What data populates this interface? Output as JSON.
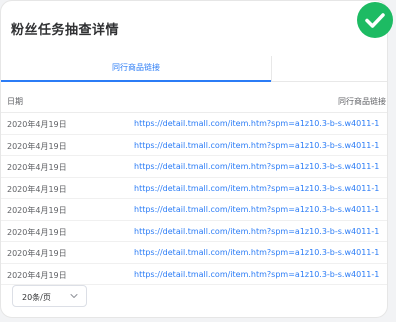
{
  "page": {
    "title": "粉丝任务抽查详情"
  },
  "tabs": [
    {
      "label": "同行商品链接",
      "active": true
    }
  ],
  "table": {
    "headers": {
      "date": "日期",
      "link": "同行商品链接"
    },
    "rows": [
      {
        "date": "2020年4月19日",
        "link": "https://detail.tmall.com/item.htm?spm=a1z10.3-b-s.w4011-1"
      },
      {
        "date": "2020年4月19日",
        "link": "https://detail.tmall.com/item.htm?spm=a1z10.3-b-s.w4011-1"
      },
      {
        "date": "2020年4月19日",
        "link": "https://detail.tmall.com/item.htm?spm=a1z10.3-b-s.w4011-1"
      },
      {
        "date": "2020年4月19日",
        "link": "https://detail.tmall.com/item.htm?spm=a1z10.3-b-s.w4011-1"
      },
      {
        "date": "2020年4月19日",
        "link": "https://detail.tmall.com/item.htm?spm=a1z10.3-b-s.w4011-1"
      },
      {
        "date": "2020年4月19日",
        "link": "https://detail.tmall.com/item.htm?spm=a1z10.3-b-s.w4011-1"
      },
      {
        "date": "2020年4月19日",
        "link": "https://detail.tmall.com/item.htm?spm=a1z10.3-b-s.w4011-1"
      },
      {
        "date": "2020年4月19日",
        "link": "https://detail.tmall.com/item.htm?spm=a1z10.3-b-s.w4011-1"
      }
    ]
  },
  "pagination": {
    "page_size_label": "20条/页"
  },
  "icons": {
    "status": "check-circle-icon",
    "dropdown": "chevron-down-icon"
  },
  "colors": {
    "accent": "#2b7cf6",
    "success": "#1dbb63",
    "title_text": "#303133",
    "body_text": "#606266"
  }
}
